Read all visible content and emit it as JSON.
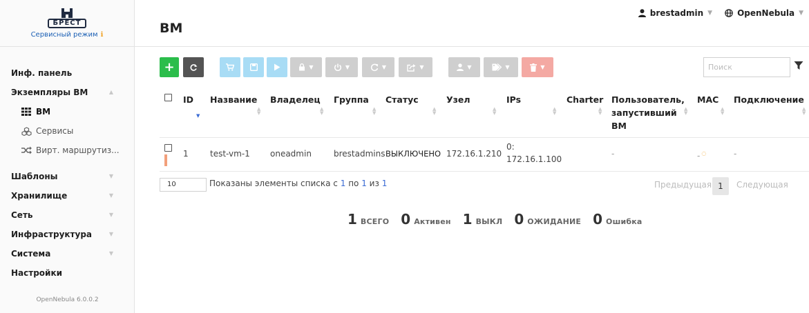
{
  "app": {
    "logo_text": "БРЕСТ",
    "service_mode": "Сервисный режим",
    "service_mode_icon": "info-icon",
    "version": "OpenNebula 6.0.0.2"
  },
  "header": {
    "title": "ВМ",
    "user": "brestadmin",
    "zone": "OpenNebula"
  },
  "sidebar": {
    "items": [
      {
        "label": "Инф. панель"
      },
      {
        "label": "Экземпляры ВМ"
      },
      {
        "label": "ВМ"
      },
      {
        "label": "Сервисы"
      },
      {
        "label": "Вирт. маршрутиз..."
      },
      {
        "label": "Шаблоны"
      },
      {
        "label": "Хранилище"
      },
      {
        "label": "Сеть"
      },
      {
        "label": "Инфраструктура"
      },
      {
        "label": "Система"
      },
      {
        "label": "Настройки"
      }
    ]
  },
  "toolbar": {
    "search_placeholder": "Поиск",
    "colors": {
      "green": "#2bbd4b",
      "gray": "#545454",
      "blue_light": "#a8dcf5",
      "gray_light": "#cfcfcf",
      "red_light": "#f4a9a3"
    }
  },
  "table": {
    "columns": [
      "ID",
      "Название",
      "Владелец",
      "Группа",
      "Статус",
      "Узел",
      "IPs",
      "Charter",
      "Пользователь, запустивший ВМ",
      "MAC",
      "Подключение"
    ],
    "rows": [
      {
        "id": "1",
        "name": "test-vm-1",
        "owner": "oneadmin",
        "group": "brestadmins",
        "status": "ВЫКЛЮЧЕНО",
        "host": "172.16.1.210",
        "ips": "0: 172.16.1.100",
        "charter": "",
        "started_by": "-",
        "mac": "-",
        "connection": "-"
      }
    ]
  },
  "pager": {
    "page_length": "10",
    "info_prefix": "Показаны элементы списка с",
    "from": "1",
    "to_label": "по",
    "to": "1",
    "of_label": "из",
    "total": "1",
    "prev": "Предыдущая",
    "current": "1",
    "next": "Следующая"
  },
  "counters": [
    {
      "n": "1",
      "label": "ВСЕГО"
    },
    {
      "n": "0",
      "label": "Активен"
    },
    {
      "n": "1",
      "label": "ВЫКЛ"
    },
    {
      "n": "0",
      "label": "ОЖИДАНИЕ"
    },
    {
      "n": "0",
      "label": "Ошибка"
    }
  ]
}
